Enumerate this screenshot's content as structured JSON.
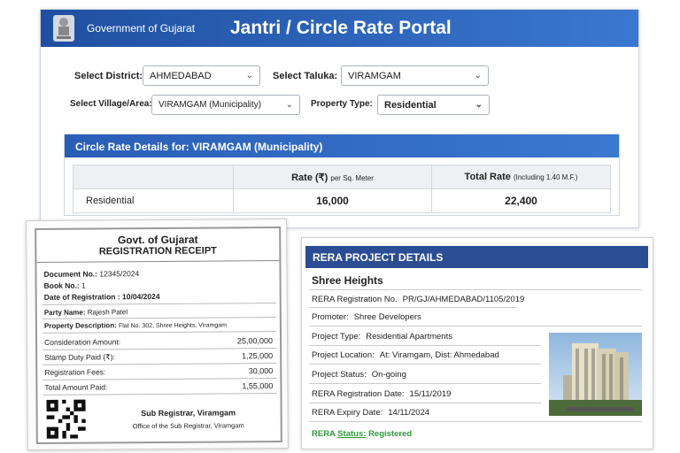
{
  "header": {
    "org": "Government of Gujarat",
    "title": "Jantri / Circle Rate Portal"
  },
  "filters": {
    "district": {
      "label": "Select District:",
      "value": "AHMEDABAD"
    },
    "taluka": {
      "label": "Select Taluka:",
      "value": "VIRAMGAM"
    },
    "village": {
      "label": "Select Village/Area:",
      "value": "VIRAMGAM (Municipality)"
    },
    "property_type": {
      "label": "Property Type:",
      "value": "Residential"
    }
  },
  "circle": {
    "title": "Circle Rate Details for: VIRAMGAM (Municipality)",
    "col_rate": "Rate (₹)",
    "col_rate_sub": "per Sq. Meter",
    "col_total": "Total Rate",
    "col_total_sub": "(Including 1.40 M.F.)",
    "row": {
      "type": "Residential",
      "rate": "16,000",
      "total": "22,400"
    }
  },
  "receipt": {
    "title1": "Govt. of Gujarat",
    "title2": "REGISTRATION RECEIPT",
    "doc_label": "Document No.:",
    "doc": "12345/2024",
    "book_label": "Book No.:",
    "book": "1",
    "date_label": "Date of Registration :",
    "date": "10/04/2024",
    "party_label": "Party Name:",
    "party": "Rajesh Patel",
    "prop_label": "Property Description:",
    "prop": "Flat No. 302, Shree Heights, Viramgam",
    "amounts": [
      {
        "label": "Consideration Amount:",
        "value": "25,00,000"
      },
      {
        "label": "Stamp Duty Paid (₹):",
        "value": "1,25,000"
      },
      {
        "label": "Registration Fees:",
        "value": "30,000"
      },
      {
        "label": "Total Amount Paid:",
        "value": "1,55,000"
      }
    ],
    "signer": "Sub Registrar, Viramgam",
    "office": "Office of the Sub Registrar, Viramgam"
  },
  "rera": {
    "title": "RERA PROJECT DETAILS",
    "project": "Shree Heights",
    "rows": [
      {
        "label": "RERA Registration No.",
        "value": "PR/GJ/AHMEDABAD/1105/2019"
      },
      {
        "label": "Promoter:",
        "value": "Shree Developers"
      },
      {
        "label": "Project Type:",
        "value": "Residential Apartments"
      },
      {
        "label": "Project Location:",
        "value": "At: Viramgam, Dist: Ahmedabad"
      },
      {
        "label": "Project Status:",
        "value": "On-going"
      },
      {
        "label": "RERA Registration Date:",
        "value": "15/11/2019"
      },
      {
        "label": "RERA Expiry Date:",
        "value": "14/11/2024"
      }
    ],
    "status_prefix": "RERA",
    "status_label": "Status:",
    "status": "Registered",
    "status_color": "#2e9a3e"
  }
}
